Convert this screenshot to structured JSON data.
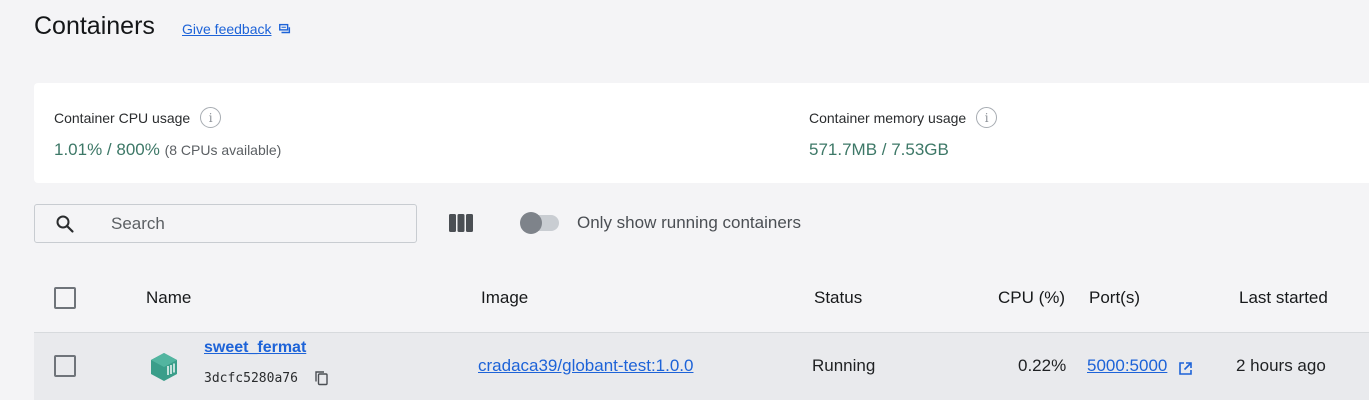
{
  "header": {
    "title": "Containers",
    "feedback_label": "Give feedback"
  },
  "stats": {
    "cpu": {
      "label": "Container CPU usage",
      "used": "1.01%",
      "separator": " / ",
      "total": "800%",
      "available": "(8 CPUs available)"
    },
    "memory": {
      "label": "Container memory usage",
      "used": "571.7MB",
      "separator": " / ",
      "total": "7.53GB"
    },
    "info_icon": "i"
  },
  "toolbar": {
    "search_placeholder": "Search",
    "columns_icon": "columns-icon",
    "toggle_label": "Only show running containers",
    "toggle_on": false
  },
  "table": {
    "columns": [
      "Name",
      "Image",
      "Status",
      "CPU (%)",
      "Port(s)",
      "Last started"
    ],
    "rows": [
      {
        "name": "sweet_fermat",
        "id": "3dcfc5280a76",
        "image": "cradaca39/globant-test:1.0.0",
        "status": "Running",
        "cpu": "0.22%",
        "ports": "5000:5000",
        "last_started": "2 hours ago"
      }
    ]
  },
  "colors": {
    "accent_link": "#1d63d8",
    "stat_value": "#3d7867",
    "container_icon": "#3a9e8a"
  }
}
